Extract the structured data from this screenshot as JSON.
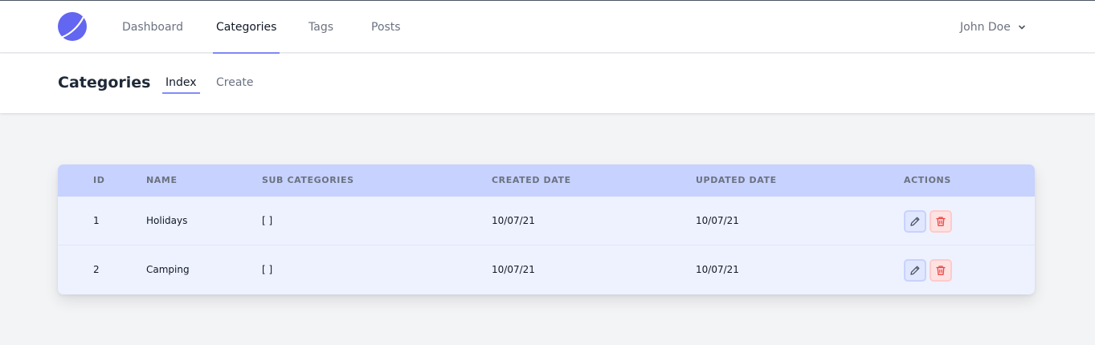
{
  "nav": {
    "items": [
      {
        "label": "Dashboard"
      },
      {
        "label": "Categories"
      },
      {
        "label": "Tags"
      },
      {
        "label": "Posts"
      }
    ],
    "active": "Categories",
    "user_name": "John Doe"
  },
  "subheader": {
    "title": "Categories",
    "tabs": [
      {
        "label": "Index"
      },
      {
        "label": "Create"
      }
    ],
    "active_tab": "Index"
  },
  "table": {
    "columns": [
      "ID",
      "NAME",
      "SUB CATEGORIES",
      "CREATED DATE",
      "UPDATED DATE",
      "ACTIONS"
    ],
    "rows": [
      {
        "id": "1",
        "name": "Holidays",
        "sub_categories": "[ ]",
        "created": "10/07/21",
        "updated": "10/07/21"
      },
      {
        "id": "2",
        "name": "Camping",
        "sub_categories": "[ ]",
        "created": "10/07/21",
        "updated": "10/07/21"
      }
    ],
    "actions": {
      "edit_icon": "pencil-icon",
      "delete_icon": "trash-icon"
    }
  },
  "colors": {
    "accent": "#818cf8",
    "table_header_bg": "#c7d2fe",
    "table_body_bg": "#eef2ff",
    "delete_red": "#ef4444"
  }
}
